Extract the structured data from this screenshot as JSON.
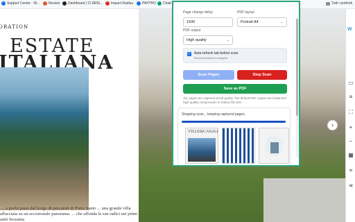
{
  "bookmarks": {
    "items": [
      {
        "label": "Support Center - W...",
        "icon": "globe-icon",
        "color": "#1a73e8"
      },
      {
        "label": "Revisio",
        "icon": "r-icon",
        "color": "#e05a2b"
      },
      {
        "label": "Dashboard | CI ARIS...",
        "icon": "github-icon",
        "color": "#222222"
      },
      {
        "label": "Impact Radius",
        "icon": "impact-icon",
        "color": "#d93025"
      },
      {
        "label": "PAYPRO",
        "icon": "paypro-icon",
        "color": "#1a73e8"
      },
      {
        "label": "Chatt",
        "icon": "chat-icon",
        "color": "#10a37f"
      }
    ],
    "all_bookmarks": "Tutti i preferiti"
  },
  "page": {
    "section": "ORATION",
    "title_line1": "ESTATE",
    "title_line2": "ITALIANA",
    "body": "..., a pochi passi dal borgo di pescatori di Porto Santo ... una grande villa affacciata su un eccezionale panorama. ... che affonda le sue radici nei primi anni Sessanta"
  },
  "popup": {
    "delay_label": "Page change delay",
    "delay_value": "1500",
    "layout_label": "PDF layout",
    "layout_value": "Portrait A4",
    "output_label": "PDF output",
    "output_value": "High quality",
    "auto_refresh_label": "Auto-refresh tab before scan",
    "auto_refresh_sub": "Recommended for Magzter",
    "auto_refresh_checked": true,
    "scan_button": "Scan Pages",
    "stop_button": "Stop Scan",
    "save_button": "Save as PDF",
    "tip": "Tip: pages are captured at full quality. The default PDF output uses balanced high-quality compression to reduce file size.",
    "status": "Stopping scan... keeping captured pages.",
    "progress": 1.0,
    "thumbnails": [
      {
        "title": "VILLE&CASALI"
      },
      {
        "title": ""
      },
      {
        "title": ""
      }
    ]
  },
  "colors": {
    "accent_border": "#2aa57a",
    "scan_button": "#8fb0f5",
    "stop_button": "#d9211e",
    "save_button": "#1e9e50",
    "progress": "#1d4fc0"
  }
}
